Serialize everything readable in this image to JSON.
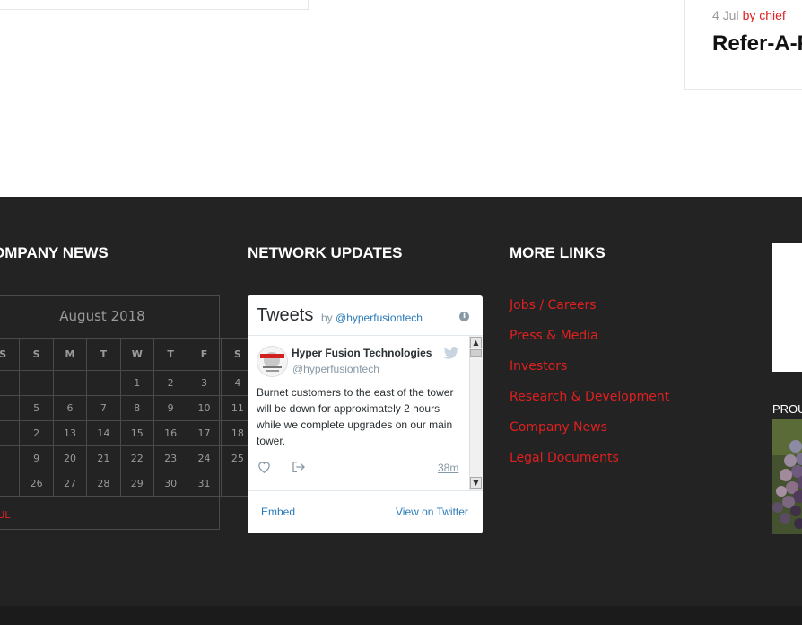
{
  "post": {
    "date": "4 Jul",
    "author": "by chief",
    "title": "Refer-A-F"
  },
  "footer": {
    "company_news": {
      "title": "OMPANY NEWS",
      "calendar": {
        "caption": "August 2018",
        "weekdays": [
          "S",
          "S",
          "M",
          "T",
          "W",
          "T",
          "F",
          "S"
        ],
        "weeks": [
          [
            "",
            "",
            "",
            "",
            "1",
            "2",
            "3",
            "4"
          ],
          [
            "",
            "5",
            "6",
            "7",
            "8",
            "9",
            "10",
            "11"
          ],
          [
            "",
            "2",
            "13",
            "14",
            "15",
            "16",
            "17",
            "18"
          ],
          [
            "",
            "9",
            "20",
            "21",
            "22",
            "23",
            "24",
            "25"
          ],
          [
            "",
            "26",
            "27",
            "28",
            "29",
            "30",
            "31",
            ""
          ]
        ],
        "prev_link": "JUL"
      }
    },
    "network_updates": {
      "title": "NETWORK UPDATES",
      "twitter": {
        "header_title": "Tweets",
        "by_text": "by",
        "by_handle": "@hyperfusiontech",
        "info_icon": "i",
        "tweet": {
          "name": "Hyper Fusion Technologies",
          "handle": "@hyperfusiontech",
          "text": "Burnet customers to the east of the tower will be down for approximately 2 hours while we complete upgrades on our main tower.",
          "time": "38m"
        },
        "embed_label": "Embed",
        "view_label": "View on Twitter"
      }
    },
    "more_links": {
      "title": "MORE LINKS",
      "links": [
        "Jobs / Careers",
        "Press & Media",
        "Investors",
        "Research & Development",
        "Company News",
        "Legal Documents"
      ]
    },
    "right": {
      "label": "PROU"
    }
  },
  "colors": {
    "footer_bg": "#232323",
    "accent": "#e02020",
    "twitter_blue": "#2b7bb9"
  }
}
